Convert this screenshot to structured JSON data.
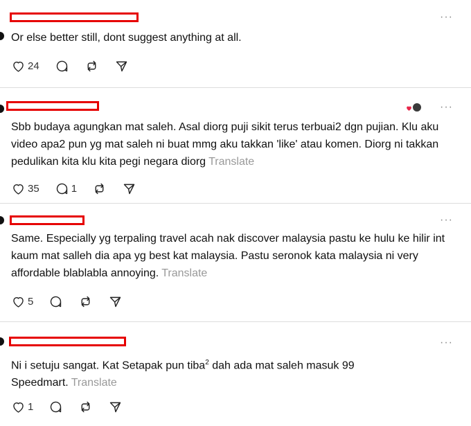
{
  "icons": {
    "like": "heart-icon",
    "reply": "speech-bubble-icon",
    "repost": "repost-icon",
    "share": "send-icon",
    "more": "more-horizontal-icon"
  },
  "ui": {
    "more_glyph": "···",
    "translate_label": "Translate"
  },
  "colors": {
    "redaction": "#e60000",
    "divider": "#dcdcdc",
    "muted": "#999999"
  },
  "posts": [
    {
      "text": "Or else better still, dont suggest anything at all.",
      "likes": "24",
      "replies": "",
      "show_translate": false
    },
    {
      "text": "Sbb budaya agungkan mat saleh. Asal diorg puji sikit terus terbuai2 dgn pujian. Klu aku video apa2 pun yg mat saleh ni buat mmg aku takkan 'like' atau komen. Diorg ni takkan pedulikan kita klu kita pegi negara diorg",
      "likes": "35",
      "replies": "1",
      "show_translate": true
    },
    {
      "text": "Same. Especially yg terpaling travel acah nak discover malaysia pastu ke hulu ke hilir int kaum mat salleh dia apa yg best kat malaysia. Pastu seronok kata malaysia ni very affordable blablabla annoying.",
      "likes": "5",
      "replies": "",
      "show_translate": true
    },
    {
      "text_a": "Ni i setuju sangat. Kat Setapak pun tiba",
      "superscript": "2",
      "text_b": " dah ada mat saleh masuk 99 Speedmart.",
      "likes": "1",
      "replies": "",
      "show_translate": true
    }
  ]
}
